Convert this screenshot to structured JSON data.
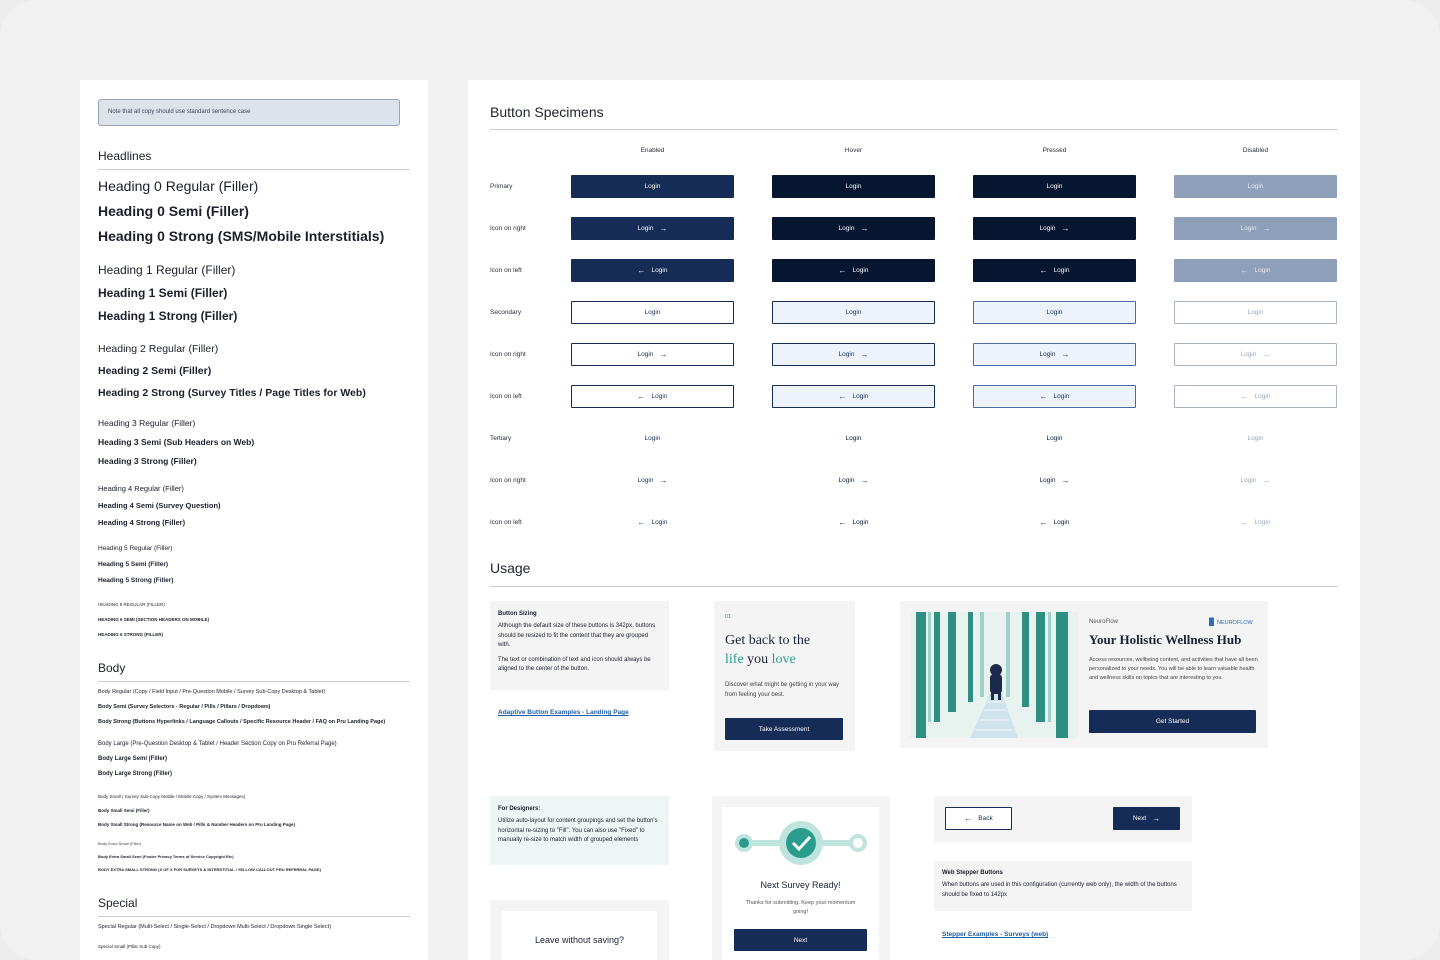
{
  "note": "Note that all copy should use standard sentence case",
  "headlines": {
    "title": "Headlines",
    "items": [
      "Heading 0 Regular (Filler)",
      "Heading 0 Semi (Filler)",
      "Heading 0 Strong (SMS/Mobile Interstitials)",
      "Heading 1 Regular (Filler)",
      "Heading 1 Semi (Filler)",
      "Heading 1 Strong (Filler)",
      "Heading 2 Regular (Filler)",
      "Heading 2 Semi (Filler)",
      "Heading 2 Strong (Survey Titles / Page Titles for Web)",
      "Heading 3 Regular (Filler)",
      "Heading 3 Semi (Sub Headers on Web)",
      "Heading 3 Strong (Filler)",
      "Heading 4 Regular (Filler)",
      "Heading 4 Semi (Survey Question)",
      "Heading 4 Strong (Filler)",
      "Heading 5 Regular (Filler)",
      "Heading 5 Semi (Filler)",
      "Heading 5 Strong (Filler)",
      "HEADING 6 REGULAR (FILLER)",
      "HEADING 6 SEMI (SECTION HEADERS ON MOBILE)",
      "HEADING 6 STRONG (FILLER)"
    ]
  },
  "body": {
    "title": "Body",
    "items": [
      "Body Regular (Copy / Field Input / Pre-Question Mobile / Survey Sub-Copy Desktop & Tablet)",
      "Body Semi (Survey Selectors - Regular / Pills / Pillars / Dropdown)",
      "Body Strong (Buttons Hyperlinks / Language Callouts / Specific Resource Header / FAQ on Pru Landing Page)",
      "Body Large (Pre-Question Desktop & Tablet / Header Section Copy on Pru Referral Page)",
      "Body Large Semi (Filler)",
      "Body Large Strong (Filler)",
      "Body Small ( Survey Sub-Copy Mobile / Mobile Copy / System Messages)",
      "Body Small Semi (Filler)",
      "Body Small Strong (Resource Name on Web / Pills & Number Headers on Pru Landing Page)",
      "Body Extra Small (Filler)",
      "Body Extra Small Semi (Footer Privacy Terms of Service Copyright Etc)",
      "BODY EXTRA SMALL STRONG (X OF X FOR SURVEYS & INTERSTITIAL / YELLOW CALLOUT PRU REFERRAL PAGE)"
    ]
  },
  "special": {
    "title": "Special",
    "items": [
      "Special Regular (Multi-Select / Single-Select / Dropdown Multi-Select / Dropdown Single Select)",
      "Special Small (Pillar Sub Copy)"
    ]
  },
  "specimens": {
    "title": "Button Specimens",
    "columns": [
      "Enabled",
      "Hover",
      "Pressed",
      "Disabled"
    ],
    "rows": [
      "Primary",
      "Icon on right",
      "Icon on left",
      "Secondary",
      "Icon on right",
      "Icon on left",
      "Tertiary",
      "Icon on right",
      "Icon on left"
    ],
    "label": "Login"
  },
  "usage": {
    "title": "Usage",
    "sizing": {
      "heading": "Button Sizing",
      "p1": "Although the default size of these buttons is 342px, buttons should be resized to fit the content that they are grouped with.",
      "p2": "The text or combination of text and icon should always be aligned to the center of the button."
    },
    "adaptive_link": "Adaptive Button Examples - Landing Page",
    "assessment": {
      "step": "01",
      "title_a": "Get back to the",
      "title_b": "life",
      "title_c": "you",
      "title_d": "love",
      "desc": "Discover what might be getting in your way from feeling your best.",
      "cta": "Take Assessment"
    },
    "hub": {
      "brand": "NeuroFlow",
      "logo": "NEUROFLOW",
      "title": "Your Holistic Wellness Hub",
      "desc": "Access resources, wellbeing content, and activities that have all been personalized to your needs. You will be able to learn valuable health and wellness skills on topics that are interesting to you.",
      "cta": "Get Started"
    },
    "designers": {
      "heading": "For Designers:",
      "text": "Utilize auto-layout for content groupings and set the button's horizontal re-sizing to \"Fill\". You can also use \"Fixed\" to manually re-size to match width of grouped elements"
    },
    "survey": {
      "title": "Next Survey Ready!",
      "desc": "Thanks for submitting. Keep your momentum going!",
      "cta": "Next"
    },
    "leave": {
      "title": "Leave without saving?"
    },
    "stepper": {
      "back": "Back",
      "next": "Next",
      "heading": "Web Stepper Buttons",
      "text": "When buttons are used in this configuration (currently web only), the width of the buttons should be fixed to 142px",
      "link": "Stepper Examples - Surveys (web)"
    }
  }
}
